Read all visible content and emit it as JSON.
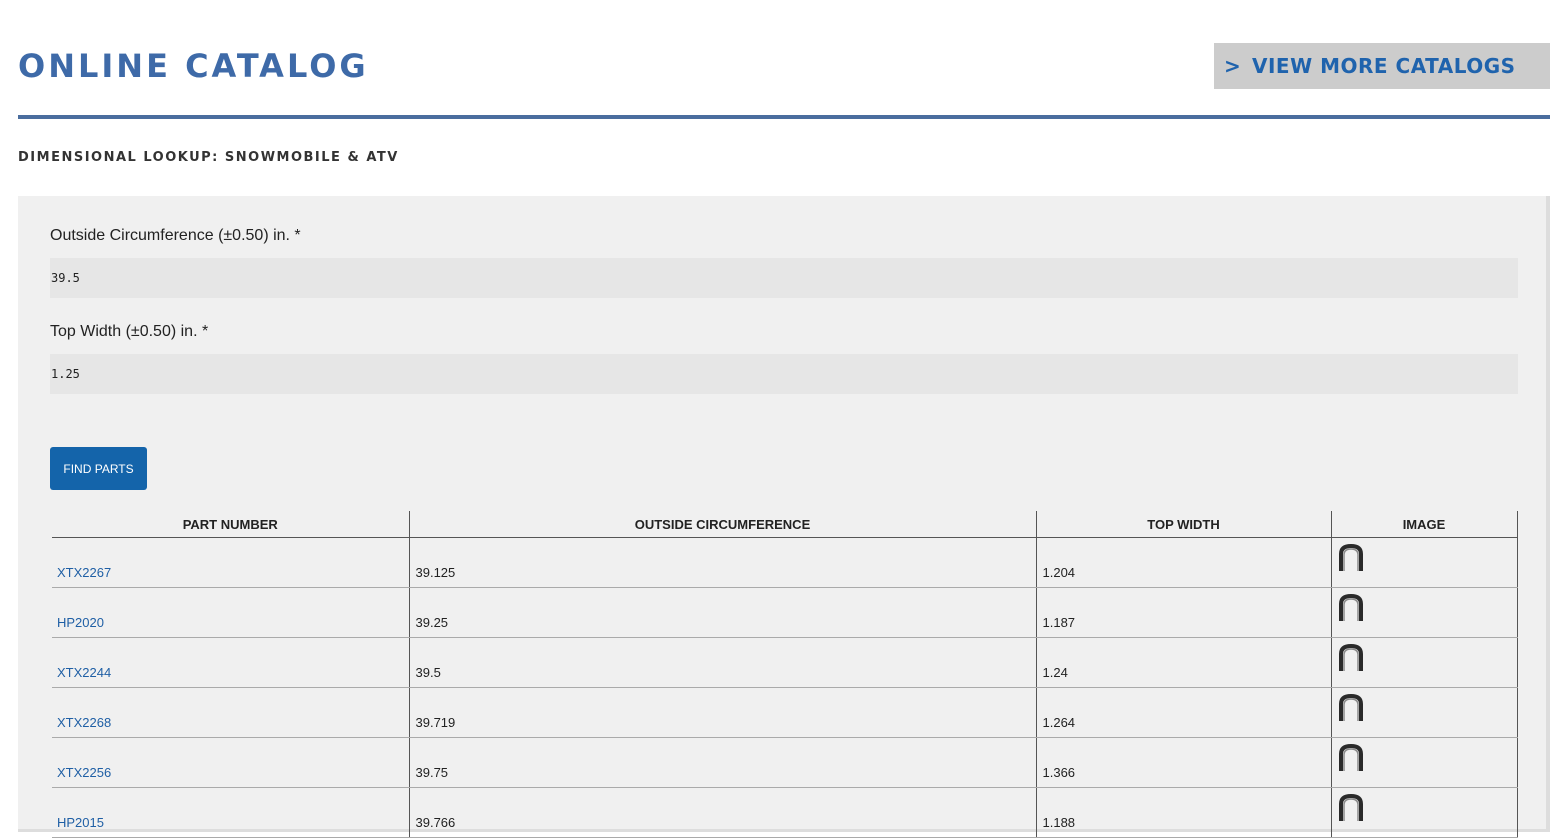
{
  "header": {
    "title": "ONLINE CATALOG",
    "more_catalogs": {
      "chevron": ">",
      "label": "VIEW MORE CATALOGS"
    }
  },
  "subtitle": "DIMENSIONAL LOOKUP: SNOWMOBILE & ATV",
  "form": {
    "outside_circumference": {
      "label": "Outside Circumference (±0.50) in. *",
      "value": "39.5"
    },
    "top_width": {
      "label": "Top Width (±0.50) in. *",
      "value": "1.25"
    },
    "submit_label": "FIND PARTS"
  },
  "results": {
    "columns": [
      "PART NUMBER",
      "OUTSIDE CIRCUMFERENCE",
      "TOP WIDTH",
      "IMAGE"
    ],
    "rows": [
      {
        "part": "XTX2267",
        "circ": "39.125",
        "width": "1.204",
        "image": "belt-thumbnail"
      },
      {
        "part": "HP2020",
        "circ": "39.25",
        "width": "1.187",
        "image": "belt-thumbnail"
      },
      {
        "part": "XTX2244",
        "circ": "39.5",
        "width": "1.24",
        "image": "belt-thumbnail"
      },
      {
        "part": "XTX2268",
        "circ": "39.719",
        "width": "1.264",
        "image": "belt-thumbnail"
      },
      {
        "part": "XTX2256",
        "circ": "39.75",
        "width": "1.366",
        "image": "belt-thumbnail"
      },
      {
        "part": "HP2015",
        "circ": "39.766",
        "width": "1.188",
        "image": "belt-thumbnail"
      }
    ]
  },
  "colors": {
    "brand_blue": "#3e6aa8",
    "button_blue": "#1464aa",
    "link_blue": "#1f5fa5",
    "panel_bg": "#f0f0f0"
  }
}
